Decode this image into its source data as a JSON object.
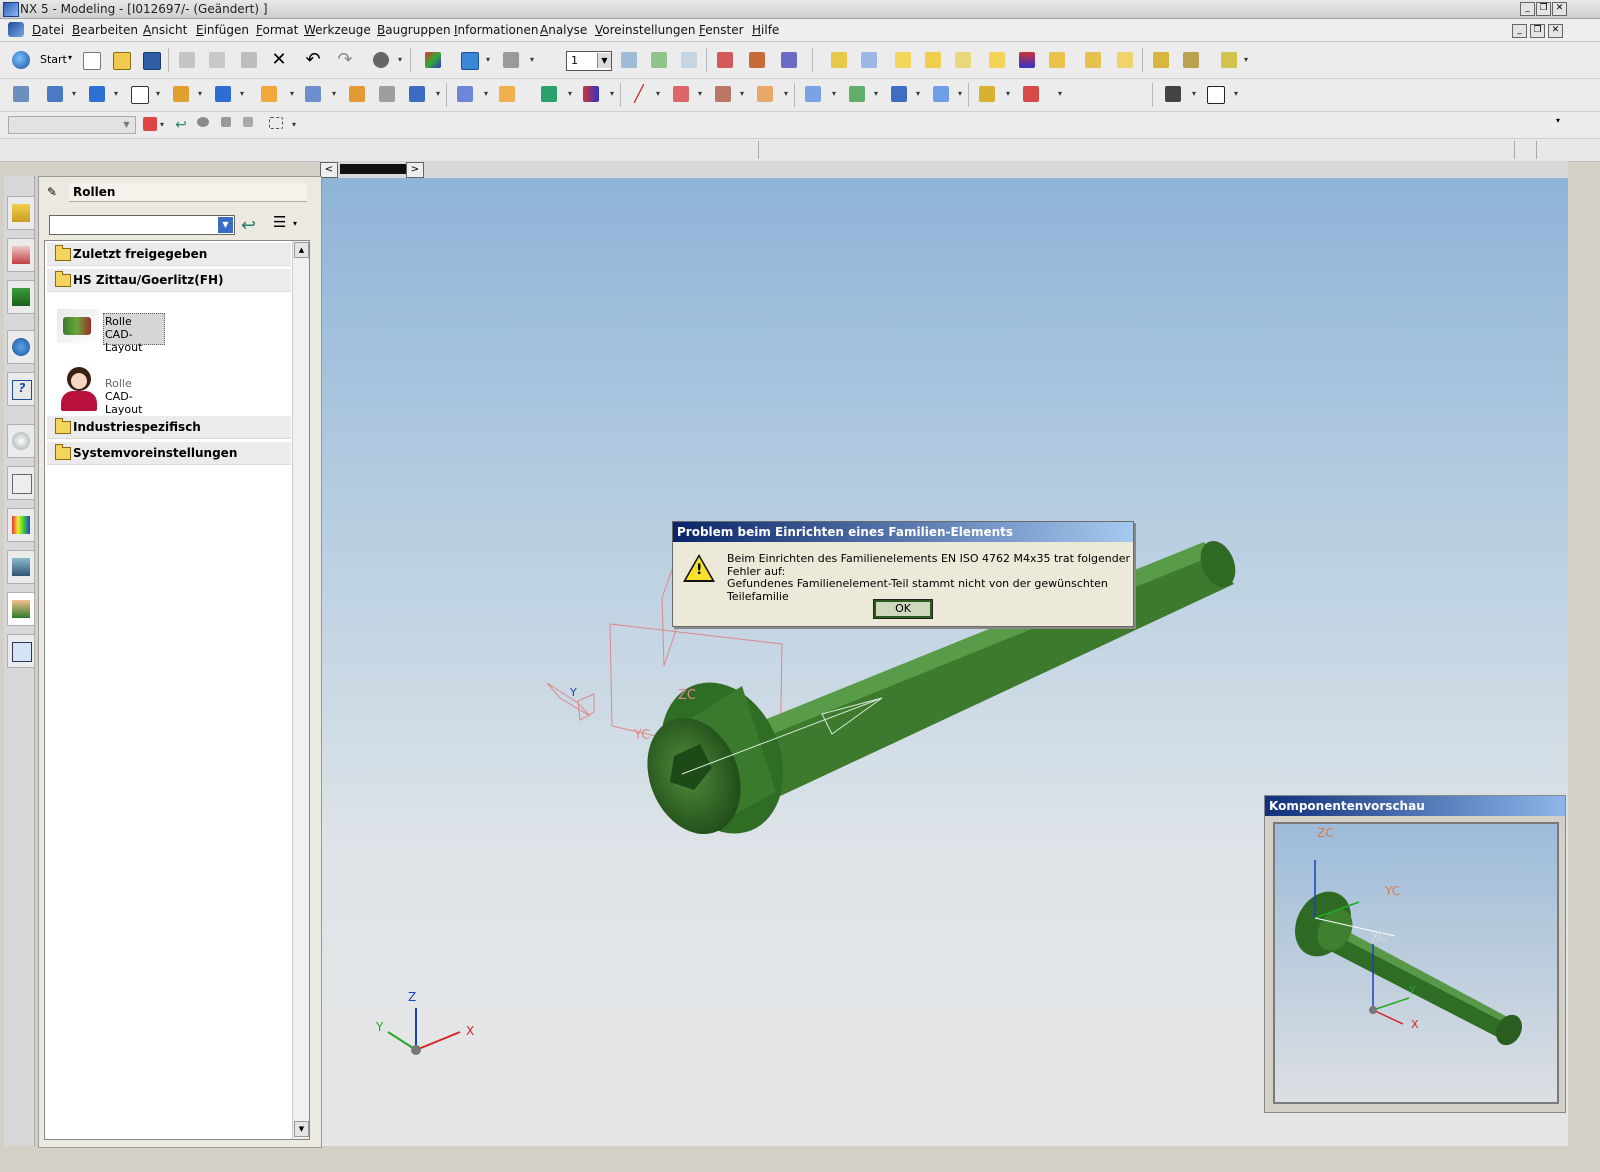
{
  "window": {
    "title": "NX 5 - Modeling - [I012697/- (Geändert) ]"
  },
  "menu": [
    "Datei",
    "Bearbeiten",
    "Ansicht",
    "Einfügen",
    "Format",
    "Werkzeuge",
    "Baugruppen",
    "Informationen",
    "Analyse",
    "Voreinstellungen",
    "Fenster",
    "Hilfe"
  ],
  "toolbar": {
    "start_label": "Start",
    "layer_value": "1"
  },
  "resource_panel": {
    "title": "Rollen",
    "folders": [
      "Zuletzt freigegeben",
      "HS Zittau/Goerlitz(FH)",
      "Industriespezifisch",
      "Systemvoreinstellungen"
    ],
    "roles": [
      {
        "line1": "Rolle",
        "line2": "CAD-Layout",
        "icon": "hs-zittau-logo-icon",
        "selected": true
      },
      {
        "line1": "Rolle",
        "line2": "CAD-Layout",
        "icon": "person-avatar-icon",
        "selected": false
      }
    ]
  },
  "dialog": {
    "title": "Problem beim Einrichten eines Familien-Elements",
    "line1": "Beim Einrichten des Familienelements EN ISO 4762 M4x35 trat folgender Fehler auf:",
    "line2": "Gefundenes Familienelement-Teil stammt nicht von der gewünschten Teilefamilie",
    "ok_label": "OK",
    "icon": "warning-icon"
  },
  "viewport": {
    "axis_labels": {
      "x": "X",
      "y": "Y",
      "z": "Z",
      "zc": "ZC",
      "yc": "YC",
      "y_small": "Y"
    }
  },
  "preview": {
    "title": "Komponentenvorschau",
    "labels": {
      "zc": "ZC",
      "yc": "YC",
      "xc": "XC",
      "y": "Y",
      "x": "X"
    }
  },
  "colors": {
    "part_green": "#3d7a2e",
    "title_blue": "#0a246a",
    "viewport_top": "#8fb4d8"
  }
}
